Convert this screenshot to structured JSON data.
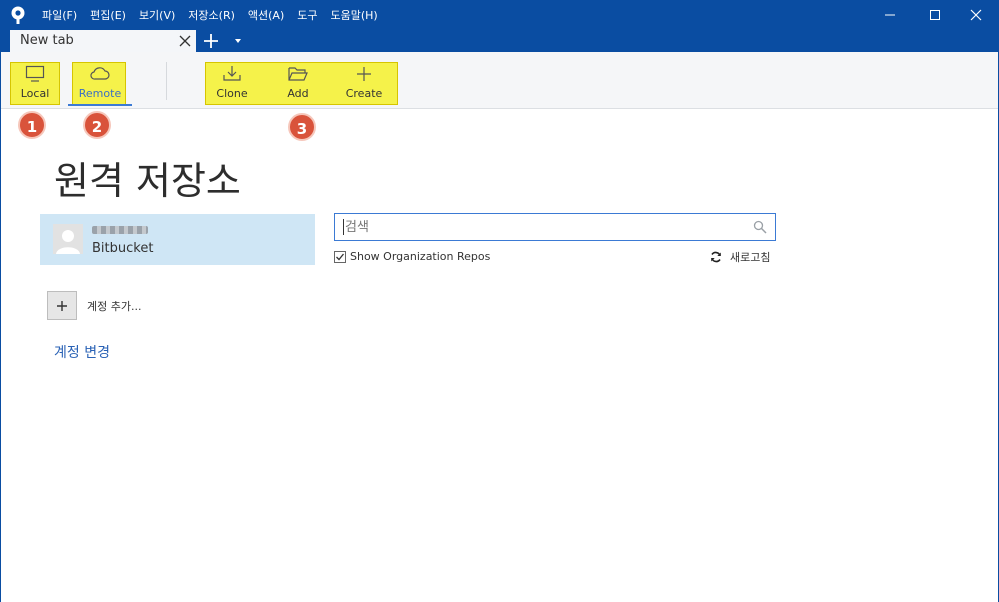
{
  "menu": {
    "items": [
      "파일(F)",
      "편집(E)",
      "보기(V)",
      "저장소(R)",
      "액션(A)",
      "도구",
      "도움말(H)"
    ]
  },
  "tabs": {
    "active_label": "New tab"
  },
  "toolbar": {
    "local_label": "Local",
    "remote_label": "Remote",
    "clone_label": "Clone",
    "add_label": "Add",
    "create_label": "Create"
  },
  "badges": [
    "1",
    "2",
    "3"
  ],
  "main": {
    "title": "원격 저장소",
    "account": {
      "provider": "Bitbucket"
    },
    "add_account_label": "계정 추가...",
    "change_account_label": "계정 변경",
    "search": {
      "placeholder": "검색"
    },
    "show_org_label": "Show Organization Repos",
    "show_org_checked": true,
    "refresh_label": "새로고침"
  },
  "colors": {
    "titlebar": "#0a4da2",
    "highlight": "#f5f24a",
    "badge": "#d9533b",
    "selection": "#cfe6f5",
    "link": "#2a62b5"
  }
}
